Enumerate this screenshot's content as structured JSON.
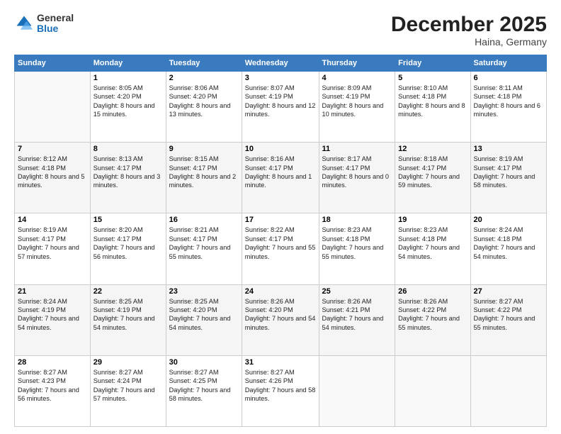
{
  "header": {
    "logo": {
      "general": "General",
      "blue": "Blue"
    },
    "title": "December 2025",
    "location": "Haina, Germany"
  },
  "days_of_week": [
    "Sunday",
    "Monday",
    "Tuesday",
    "Wednesday",
    "Thursday",
    "Friday",
    "Saturday"
  ],
  "weeks": [
    [
      {
        "day": "",
        "sunrise": "",
        "sunset": "",
        "daylight": "",
        "empty": true
      },
      {
        "day": "1",
        "sunrise": "Sunrise: 8:05 AM",
        "sunset": "Sunset: 4:20 PM",
        "daylight": "Daylight: 8 hours and 15 minutes."
      },
      {
        "day": "2",
        "sunrise": "Sunrise: 8:06 AM",
        "sunset": "Sunset: 4:20 PM",
        "daylight": "Daylight: 8 hours and 13 minutes."
      },
      {
        "day": "3",
        "sunrise": "Sunrise: 8:07 AM",
        "sunset": "Sunset: 4:19 PM",
        "daylight": "Daylight: 8 hours and 12 minutes."
      },
      {
        "day": "4",
        "sunrise": "Sunrise: 8:09 AM",
        "sunset": "Sunset: 4:19 PM",
        "daylight": "Daylight: 8 hours and 10 minutes."
      },
      {
        "day": "5",
        "sunrise": "Sunrise: 8:10 AM",
        "sunset": "Sunset: 4:18 PM",
        "daylight": "Daylight: 8 hours and 8 minutes."
      },
      {
        "day": "6",
        "sunrise": "Sunrise: 8:11 AM",
        "sunset": "Sunset: 4:18 PM",
        "daylight": "Daylight: 8 hours and 6 minutes."
      }
    ],
    [
      {
        "day": "7",
        "sunrise": "Sunrise: 8:12 AM",
        "sunset": "Sunset: 4:18 PM",
        "daylight": "Daylight: 8 hours and 5 minutes."
      },
      {
        "day": "8",
        "sunrise": "Sunrise: 8:13 AM",
        "sunset": "Sunset: 4:17 PM",
        "daylight": "Daylight: 8 hours and 3 minutes."
      },
      {
        "day": "9",
        "sunrise": "Sunrise: 8:15 AM",
        "sunset": "Sunset: 4:17 PM",
        "daylight": "Daylight: 8 hours and 2 minutes."
      },
      {
        "day": "10",
        "sunrise": "Sunrise: 8:16 AM",
        "sunset": "Sunset: 4:17 PM",
        "daylight": "Daylight: 8 hours and 1 minute."
      },
      {
        "day": "11",
        "sunrise": "Sunrise: 8:17 AM",
        "sunset": "Sunset: 4:17 PM",
        "daylight": "Daylight: 8 hours and 0 minutes."
      },
      {
        "day": "12",
        "sunrise": "Sunrise: 8:18 AM",
        "sunset": "Sunset: 4:17 PM",
        "daylight": "Daylight: 7 hours and 59 minutes."
      },
      {
        "day": "13",
        "sunrise": "Sunrise: 8:19 AM",
        "sunset": "Sunset: 4:17 PM",
        "daylight": "Daylight: 7 hours and 58 minutes."
      }
    ],
    [
      {
        "day": "14",
        "sunrise": "Sunrise: 8:19 AM",
        "sunset": "Sunset: 4:17 PM",
        "daylight": "Daylight: 7 hours and 57 minutes."
      },
      {
        "day": "15",
        "sunrise": "Sunrise: 8:20 AM",
        "sunset": "Sunset: 4:17 PM",
        "daylight": "Daylight: 7 hours and 56 minutes."
      },
      {
        "day": "16",
        "sunrise": "Sunrise: 8:21 AM",
        "sunset": "Sunset: 4:17 PM",
        "daylight": "Daylight: 7 hours and 55 minutes."
      },
      {
        "day": "17",
        "sunrise": "Sunrise: 8:22 AM",
        "sunset": "Sunset: 4:17 PM",
        "daylight": "Daylight: 7 hours and 55 minutes."
      },
      {
        "day": "18",
        "sunrise": "Sunrise: 8:23 AM",
        "sunset": "Sunset: 4:18 PM",
        "daylight": "Daylight: 7 hours and 55 minutes."
      },
      {
        "day": "19",
        "sunrise": "Sunrise: 8:23 AM",
        "sunset": "Sunset: 4:18 PM",
        "daylight": "Daylight: 7 hours and 54 minutes."
      },
      {
        "day": "20",
        "sunrise": "Sunrise: 8:24 AM",
        "sunset": "Sunset: 4:18 PM",
        "daylight": "Daylight: 7 hours and 54 minutes."
      }
    ],
    [
      {
        "day": "21",
        "sunrise": "Sunrise: 8:24 AM",
        "sunset": "Sunset: 4:19 PM",
        "daylight": "Daylight: 7 hours and 54 minutes."
      },
      {
        "day": "22",
        "sunrise": "Sunrise: 8:25 AM",
        "sunset": "Sunset: 4:19 PM",
        "daylight": "Daylight: 7 hours and 54 minutes."
      },
      {
        "day": "23",
        "sunrise": "Sunrise: 8:25 AM",
        "sunset": "Sunset: 4:20 PM",
        "daylight": "Daylight: 7 hours and 54 minutes."
      },
      {
        "day": "24",
        "sunrise": "Sunrise: 8:26 AM",
        "sunset": "Sunset: 4:20 PM",
        "daylight": "Daylight: 7 hours and 54 minutes."
      },
      {
        "day": "25",
        "sunrise": "Sunrise: 8:26 AM",
        "sunset": "Sunset: 4:21 PM",
        "daylight": "Daylight: 7 hours and 54 minutes."
      },
      {
        "day": "26",
        "sunrise": "Sunrise: 8:26 AM",
        "sunset": "Sunset: 4:22 PM",
        "daylight": "Daylight: 7 hours and 55 minutes."
      },
      {
        "day": "27",
        "sunrise": "Sunrise: 8:27 AM",
        "sunset": "Sunset: 4:22 PM",
        "daylight": "Daylight: 7 hours and 55 minutes."
      }
    ],
    [
      {
        "day": "28",
        "sunrise": "Sunrise: 8:27 AM",
        "sunset": "Sunset: 4:23 PM",
        "daylight": "Daylight: 7 hours and 56 minutes."
      },
      {
        "day": "29",
        "sunrise": "Sunrise: 8:27 AM",
        "sunset": "Sunset: 4:24 PM",
        "daylight": "Daylight: 7 hours and 57 minutes."
      },
      {
        "day": "30",
        "sunrise": "Sunrise: 8:27 AM",
        "sunset": "Sunset: 4:25 PM",
        "daylight": "Daylight: 7 hours and 58 minutes."
      },
      {
        "day": "31",
        "sunrise": "Sunrise: 8:27 AM",
        "sunset": "Sunset: 4:26 PM",
        "daylight": "Daylight: 7 hours and 58 minutes."
      },
      {
        "day": "",
        "sunrise": "",
        "sunset": "",
        "daylight": "",
        "empty": true
      },
      {
        "day": "",
        "sunrise": "",
        "sunset": "",
        "daylight": "",
        "empty": true
      },
      {
        "day": "",
        "sunrise": "",
        "sunset": "",
        "daylight": "",
        "empty": true
      }
    ]
  ]
}
